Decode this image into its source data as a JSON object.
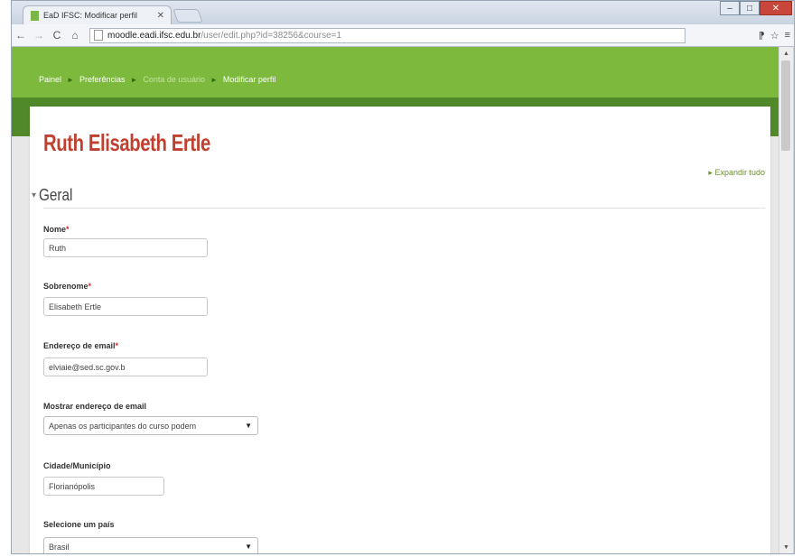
{
  "browser": {
    "tab_title": "EaD IFSC: Modificar perfil",
    "url_host": "moodle.eadi.ifsc.edu.br",
    "url_path": "/user/edit.php?id=38256&course=1"
  },
  "breadcrumb": {
    "items": [
      "Painel",
      "Preferências",
      "Conta de usuário",
      "Modificar perfil"
    ]
  },
  "profile": {
    "full_name": "Ruth Elisabeth Ertle",
    "expand_all": "Expandir tudo",
    "section_title": "Geral"
  },
  "form": {
    "nome_label": "Nome",
    "nome_value": "Ruth",
    "sobrenome_label": "Sobrenome",
    "sobrenome_value": "Elisabeth Ertle",
    "email_label": "Endereço de email",
    "email_value": "elviaie@sed.sc.gov.b",
    "mostrar_label": "Mostrar endereço de email",
    "mostrar_value": "Apenas os participantes do curso podem",
    "cidade_label": "Cidade/Município",
    "cidade_value": "Florianópolis",
    "pais_label": "Selecione um país",
    "pais_value": "Brasil",
    "required_mark": "*"
  },
  "colors": {
    "green_bar": "#7cb93c",
    "dark_green_bar": "#50892a",
    "name_red": "#c0402f"
  },
  "icons": [
    "favicon-icon",
    "tab-close-icon",
    "back-icon",
    "forward-icon",
    "reload-icon",
    "home-icon",
    "page-icon",
    "translate-icon",
    "star-icon",
    "menu-icon",
    "expand-icon",
    "collapse-icon",
    "dropdown-arrow-icon"
  ]
}
